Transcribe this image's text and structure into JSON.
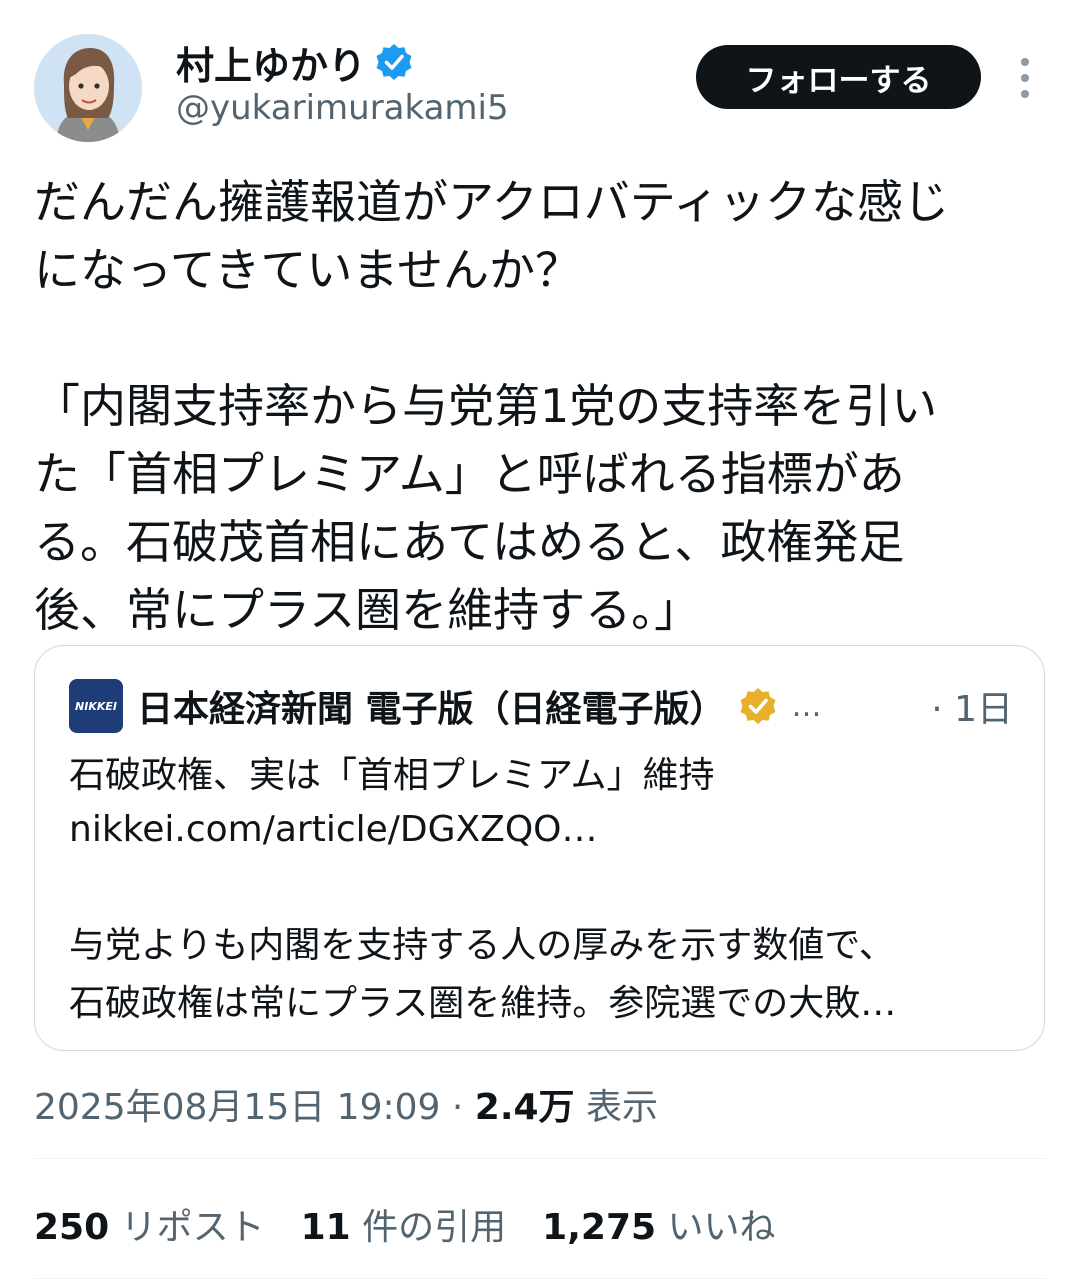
{
  "user": {
    "name": "村上ゆかり",
    "handle": "@yukarimurakami5",
    "verified_color": "#1d9bf0"
  },
  "follow_button": {
    "label": "フォローする"
  },
  "tweet": {
    "lines": [
      "だんだん擁護報道がアクロバティックな感じ",
      "になってきていませんか？",
      "",
      "「内閣支持率から与党第1党の支持率を引い",
      "た「首相プレミアム」と呼ばれる指標があ",
      "る。石破茂首相にあてはめると、政権発足",
      "後、常にプラス圏を維持する。」"
    ]
  },
  "quoted_card": {
    "logo_text": "NIKKEI",
    "source": "日本経済新聞 電子版（日経電子版）",
    "ellipsis": "…",
    "time": "· 1日",
    "badge_color": "#e8b02a",
    "headline": "石破政権、実は「首相プレミアム」維持",
    "url": "nikkei.com/article/DGXZQO…",
    "summary_line1": "与党よりも内閣を支持する人の厚みを示す数値で、",
    "summary_line2": "石破政権は常にプラス圏を維持。参院選での大敗…"
  },
  "meta": {
    "datetime": "2025年08月15日 19:09",
    "separator": " · ",
    "views": "2.4万",
    "views_label": " 表示"
  },
  "stats": {
    "reposts_count": "250",
    "reposts_label": " リポスト",
    "quotes_count": "11",
    "quotes_label": " 件の引用",
    "likes_count": "1,275",
    "likes_label": " いいね"
  }
}
